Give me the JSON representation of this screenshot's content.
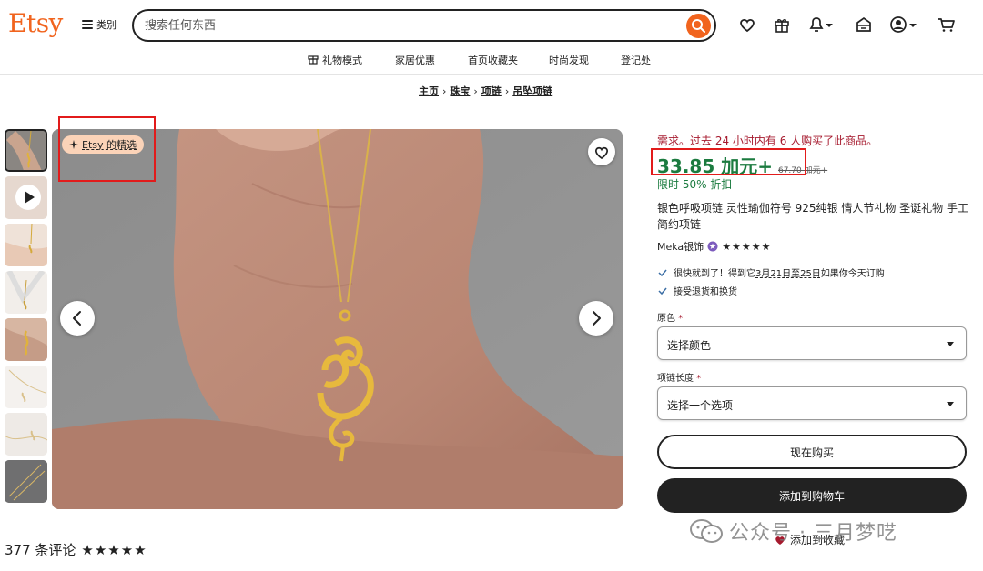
{
  "header": {
    "logo": "Etsy",
    "categories_label": "类别",
    "search_placeholder": "搜索任何东西"
  },
  "subnav": [
    "礼物模式",
    "家居优惠",
    "首页收藏夹",
    "时尚发现",
    "登记处"
  ],
  "breadcrumb": [
    "主页",
    "珠宝",
    "项链",
    "吊坠项链"
  ],
  "badge": {
    "label": "Etsy 的精选"
  },
  "product": {
    "demand": "需求。过去 24 小时内有 6 人购买了此商品。",
    "price": "33.85 加元+",
    "old_price": "67.70 加元+",
    "discount": "限时 50% 折扣",
    "title": "银色呼吸项链 灵性瑜伽符号 925纯银 情人节礼物 圣诞礼物 手工简约项链",
    "shop": "Meka银饰",
    "shop_stars": "★★★★★",
    "delivery_pre": "很快就到了！得到它",
    "delivery_dates": "3月21日至25日",
    "delivery_post": "如果你今天订购",
    "returns": "接受退货和换货",
    "color_label": "原色",
    "color_value": "选择颜色",
    "length_label": "项链长度",
    "length_value": "选择一个选项",
    "buy_now": "现在购买",
    "add_to_cart": "添加到购物车",
    "add_to_fav": "添加到收藏"
  },
  "reviews": {
    "count": "377 条评论",
    "stars": "★★★★★"
  },
  "watermark": "公众号 · 三月梦呓",
  "colors": {
    "brand": "#f1641e",
    "price": "#1b7b3f",
    "demand": "#a61a2e",
    "annotation": "#e21b1b"
  }
}
